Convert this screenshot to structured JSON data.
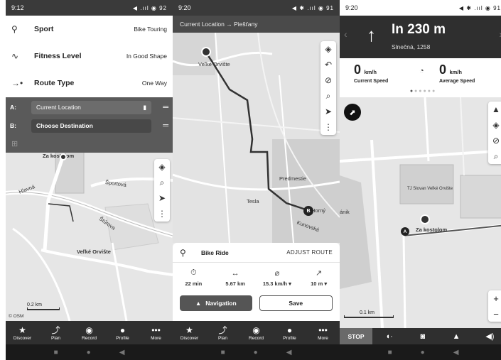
{
  "screen1": {
    "status": {
      "time": "9:12",
      "icons": "◀ .ııl ◉ 92"
    },
    "menu": [
      {
        "label": "Sport",
        "value": "Bike Touring"
      },
      {
        "label": "Fitness Level",
        "value": "In Good Shape"
      },
      {
        "label": "Route Type",
        "value": "One Way"
      }
    ],
    "route": {
      "a_label": "A:",
      "a_value": "Current Location",
      "b_label": "B:",
      "b_value": "Choose Destination"
    },
    "map_labels": {
      "place1": "Za kostolom",
      "road1": "Hlavná",
      "road2": "Športová",
      "road3": "Štúrova",
      "town": "Veľké Orvište"
    },
    "scale": "0.2 km",
    "attribution": "© OSM",
    "nav": [
      {
        "label": "Discover",
        "icon": "★"
      },
      {
        "label": "Plan",
        "icon": "⤴"
      },
      {
        "label": "Record",
        "icon": "◉"
      },
      {
        "label": "Profile",
        "icon": "●"
      },
      {
        "label": "More",
        "icon": "•••"
      }
    ]
  },
  "screen2": {
    "status": {
      "time": "9:20",
      "icons": "◀ ✱ .ııl ◉ 91"
    },
    "header": "Current Location → Piešťany",
    "map_labels": {
      "start": "Veľké Orvište",
      "town1": "Predmestie",
      "town2": "Tesla",
      "town3": "Kunovská",
      "town4": "Horný"
    },
    "sheet": {
      "name": "Bike Ride",
      "adjust": "ADJUST ROUTE"
    },
    "stats": [
      {
        "icon": "⏱",
        "value": "22 min"
      },
      {
        "icon": "↔",
        "value": "5.67 km"
      },
      {
        "icon": "⌀",
        "value": "15.3 km/h ▾"
      },
      {
        "icon": "↗",
        "value": "10 m ▾"
      }
    ],
    "buttons": {
      "navigation": "Navigation",
      "save": "Save"
    },
    "nav": [
      {
        "label": "Discover",
        "icon": "★"
      },
      {
        "label": "Plan",
        "icon": "⤴"
      },
      {
        "label": "Record",
        "icon": "◉"
      },
      {
        "label": "Profile",
        "icon": "●"
      },
      {
        "label": "More",
        "icon": "•••"
      }
    ]
  },
  "screen3": {
    "status": {
      "time": "9:20",
      "icons": "◀ ✱ .ııl ◉ 91"
    },
    "banner": {
      "distance": "In 230 m",
      "street": "Slnečná, 1258"
    },
    "current_speed": {
      "value": "0",
      "unit": "km/h",
      "label": "Current Speed"
    },
    "average_speed": {
      "value": "0",
      "unit": "km/h",
      "label": "Average Speed"
    },
    "map_labels": {
      "place": "Za kostolom",
      "area": "TJ Slovan Veľké Orvište",
      "left": "ánik"
    },
    "scale": "0.1 km",
    "stop": "STOP"
  }
}
